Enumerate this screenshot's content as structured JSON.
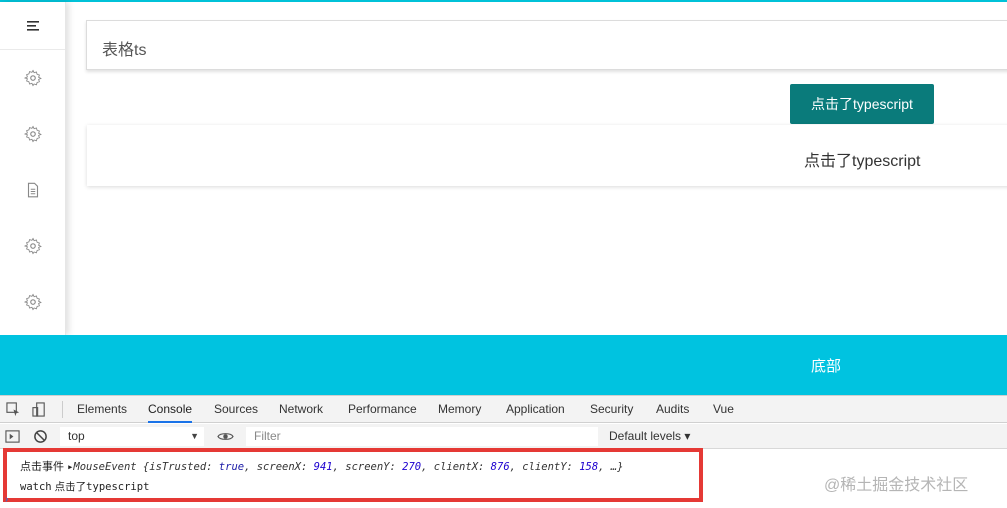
{
  "app": {
    "title_box": "表格ts",
    "button_label": "点击了typescript",
    "card_text": "点击了typescript",
    "footer_text": "底部",
    "sidebar": {
      "toggle_icon": "menu-icon",
      "items": [
        {
          "icon": "gear-icon"
        },
        {
          "icon": "gear-icon"
        },
        {
          "icon": "document-icon"
        },
        {
          "icon": "gear-icon"
        },
        {
          "icon": "gear-icon"
        }
      ]
    },
    "colors": {
      "accent": "#00c2d8",
      "footer": "#00c3e0",
      "button": "#0a7b7b"
    }
  },
  "devtools": {
    "tabs": [
      "Elements",
      "Console",
      "Sources",
      "Network",
      "Performance",
      "Memory",
      "Application",
      "Security",
      "Audits",
      "Vue"
    ],
    "active_tab": "Console",
    "context": "top",
    "filter_placeholder": "Filter",
    "levels": "Default levels",
    "logs": {
      "line1_prefix": "点击事件",
      "line1_type": "MouseEvent",
      "line1_open": " {isTrusted: ",
      "line1_true": "true",
      "line1_sx": ", screenX: ",
      "line1_sx_val": "941",
      "line1_sy": ", screenY: ",
      "line1_sy_val": "270",
      "line1_cx": ", clientX: ",
      "line1_cx_val": "876",
      "line1_cy": ", clientY: ",
      "line1_cy_val": "158",
      "line1_end": ", …}",
      "line2_prefix": "watch",
      "line2_text": "点击了typescript"
    },
    "prompt_glyph": "›"
  },
  "watermark": "@稀土掘金技术社区"
}
